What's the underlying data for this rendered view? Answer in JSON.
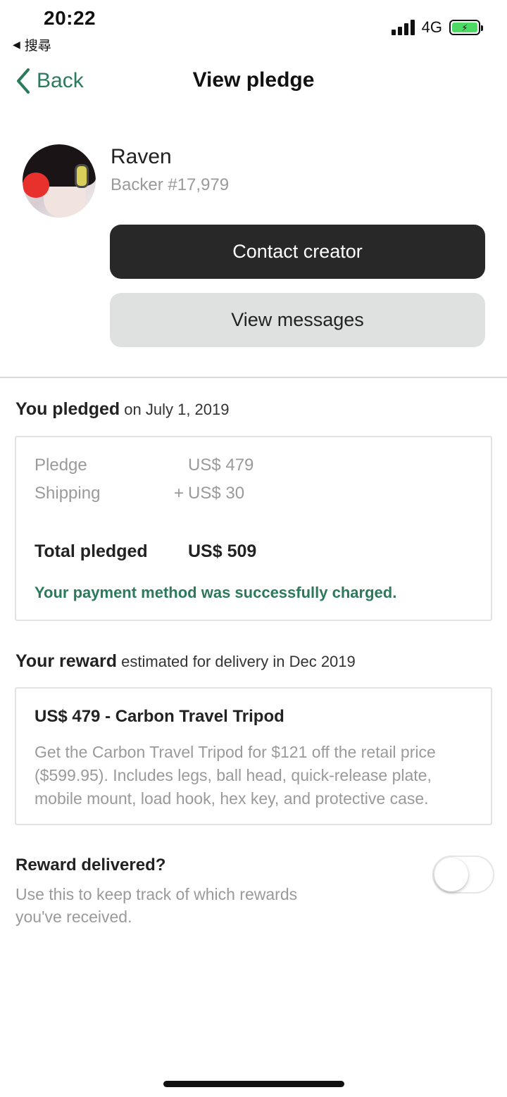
{
  "status_bar": {
    "time": "20:22",
    "back_app_label": "搜尋",
    "network": "4G",
    "icons": [
      "signal-icon",
      "battery-charging-icon"
    ]
  },
  "nav": {
    "back_label": "Back",
    "title": "View pledge"
  },
  "profile": {
    "name": "Raven",
    "backer_number": "Backer #17,979"
  },
  "buttons": {
    "contact_creator": "Contact creator",
    "view_messages": "View messages"
  },
  "pledge": {
    "heading": "You pledged",
    "date_text": " on July 1, 2019",
    "rows": {
      "pledge_label": "Pledge",
      "pledge_value": "US$ 479",
      "shipping_label": "Shipping",
      "shipping_prefix": "+",
      "shipping_value": "US$ 30",
      "total_label": "Total pledged",
      "total_value": "US$ 509"
    },
    "charged_message": "Your payment method was successfully charged."
  },
  "reward": {
    "heading": "Your reward",
    "delivery_text": " estimated for delivery in Dec 2019",
    "title": "US$ 479 - Carbon Travel Tripod",
    "description": "Get the Carbon Travel Tripod for $121 off the retail price ($599.95). Includes legs, ball head, quick-release plate, mobile mount, load hook, hex key, and protective case."
  },
  "delivered": {
    "title": "Reward delivered?",
    "description": "Use this to keep track of which rewards you've received.",
    "toggle_on": false
  },
  "colors": {
    "accent_green": "#2b7a5b",
    "dark_button": "#282828",
    "light_button": "#dfe0e0"
  }
}
